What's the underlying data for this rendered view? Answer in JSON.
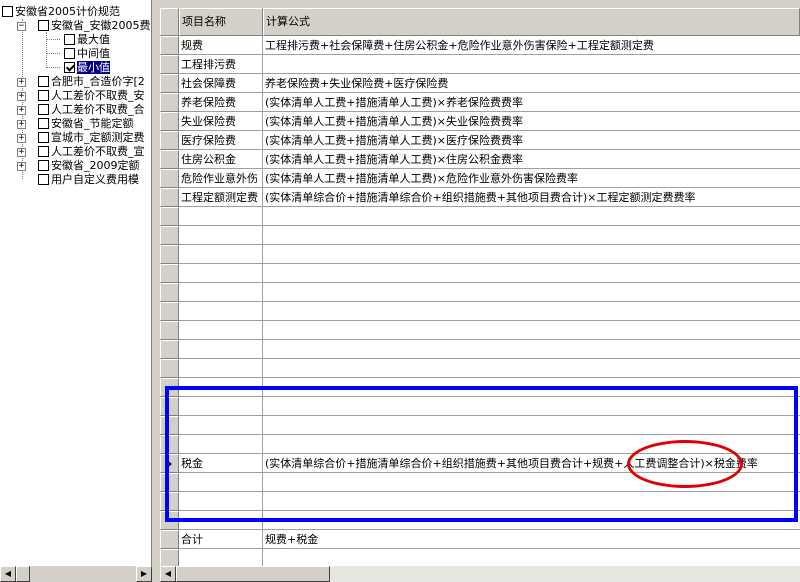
{
  "tree": {
    "root": "安徽省2005计价规范",
    "child": "安徽省_安徽2005费",
    "options": [
      "最大值",
      "中间值",
      "最小值"
    ],
    "items": [
      "合肥市_合造价字[2",
      "人工差价不取费_安",
      "人工差价不取费_合",
      "安徽省_节能定额",
      "宣城市_定额测定费",
      "人工差价不取费_宣",
      "安徽省_2009定额",
      "用户自定义费用模"
    ]
  },
  "grid": {
    "headers": {
      "name": "项目名称",
      "formula": "计算公式"
    },
    "rows": [
      {
        "name": "规费",
        "formula": "工程排污费+社会保障费+住房公积金+危险作业意外伤害保险+工程定额测定费"
      },
      {
        "name": "工程排污费",
        "formula": ""
      },
      {
        "name": "社会保障费",
        "formula": "养老保险费+失业保险费+医疗保险费"
      },
      {
        "name": "养老保险费",
        "formula": "(实体清单人工费+措施清单人工费)×养老保险费费率"
      },
      {
        "name": "失业保险费",
        "formula": "(实体清单人工费+措施清单人工费)×失业保险费费率"
      },
      {
        "name": "医疗保险费",
        "formula": "(实体清单人工费+措施清单人工费)×医疗保险费费率"
      },
      {
        "name": "住房公积金",
        "formula": "(实体清单人工费+措施清单人工费)×住房公积金费率"
      },
      {
        "name": "危险作业意外伤",
        "formula": "(实体清单人工费+措施清单人工费)×危险作业意外伤害保险费率"
      },
      {
        "name": "工程定额测定费",
        "formula": "(实体清单综合价+措施清单综合价+组织措施费+其他项目费合计)×工程定额测定费费率"
      }
    ],
    "tax": {
      "name": "税金",
      "formula": "(实体清单综合价+措施清单综合价+组织措施费+其他项目费合计+规费+人工费调整合计)×税金费率"
    },
    "total": {
      "name": "合计",
      "formula": "规费+税金"
    }
  },
  "icons": {
    "expand": "plus-box",
    "collapse": "minus-box",
    "current_row": "right-arrow",
    "scroll_left": "left-arrow",
    "scroll_right": "right-arrow"
  },
  "colors": {
    "annotation_box": "#0000ff",
    "annotation_ellipse": "#e00000",
    "selection": "#000080"
  }
}
